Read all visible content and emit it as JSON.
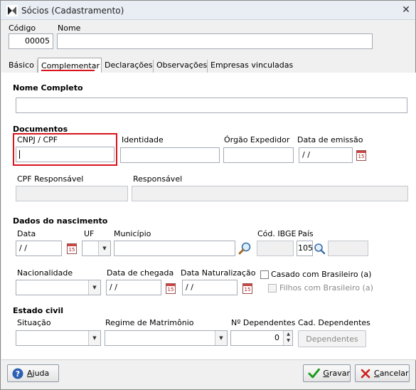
{
  "window": {
    "title": "Sócios (Cadastramento)",
    "close": "✕"
  },
  "header": {
    "codigo_label": "Código",
    "codigo_value": "00005",
    "nome_label": "Nome",
    "nome_value": ""
  },
  "tabs": [
    {
      "label": "Básico"
    },
    {
      "label": "Complementar"
    },
    {
      "label": "Declarações"
    },
    {
      "label": "Observações"
    },
    {
      "label": "Empresas vinculadas"
    }
  ],
  "form": {
    "nome_completo_label": "Nome Completo",
    "nome_completo_value": "",
    "documentos_title": "Documentos",
    "cnpj_label": "CNPJ / CPF",
    "cnpj_value": "",
    "identidade_label": "Identidade",
    "identidade_value": "",
    "orgao_label": "Órgão Expedidor",
    "orgao_value": "",
    "data_emissao_label": "Data de emissão",
    "data_emissao_value": " /  /",
    "cpf_resp_label": "CPF Responsável",
    "cpf_resp_value": "",
    "responsavel_label": "Responsável",
    "responsavel_value": "",
    "nascimento_title": "Dados do nascimento",
    "data_label": "Data",
    "data_value": " /  /",
    "uf_label": "UF",
    "uf_value": "",
    "municipio_label": "Município",
    "municipio_value": "",
    "cod_ibge_label": "Cód. IBGE",
    "cod_ibge_value": "",
    "pais_label": "País",
    "pais_value": "105",
    "pais_name": "",
    "nacionalidade_label": "Nacionalidade",
    "nacionalidade_value": "",
    "data_chegada_label": "Data de chegada",
    "data_chegada_value": " /  /",
    "data_nat_label": "Data Naturalização",
    "data_nat_value": " /  /",
    "casado_label": "Casado com Brasileiro (a)",
    "filhos_label": "Filhos com Brasileiro (a)",
    "estado_civil_title": "Estado civil",
    "situacao_label": "Situação",
    "situacao_value": "",
    "regime_label": "Regime de Matrimônio",
    "regime_value": "",
    "n_dependentes_label": "Nº Dependentes",
    "n_dependentes_value": "0",
    "cad_dependentes_label": "Cad. Dependentes",
    "dependentes_button": "Dependentes",
    "calendar_text": "15"
  },
  "footer": {
    "ajuda_a": "A",
    "ajuda_rest": "juda",
    "gravar_a": "G",
    "gravar_rest": "ravar",
    "cancelar_a": "C",
    "cancelar_rest": "ancelar"
  },
  "colors": {
    "highlight": "#d9141c",
    "ok_green": "#1a9a1a",
    "cancel_red": "#cc1f1f",
    "help_blue": "#2b5fb3"
  }
}
